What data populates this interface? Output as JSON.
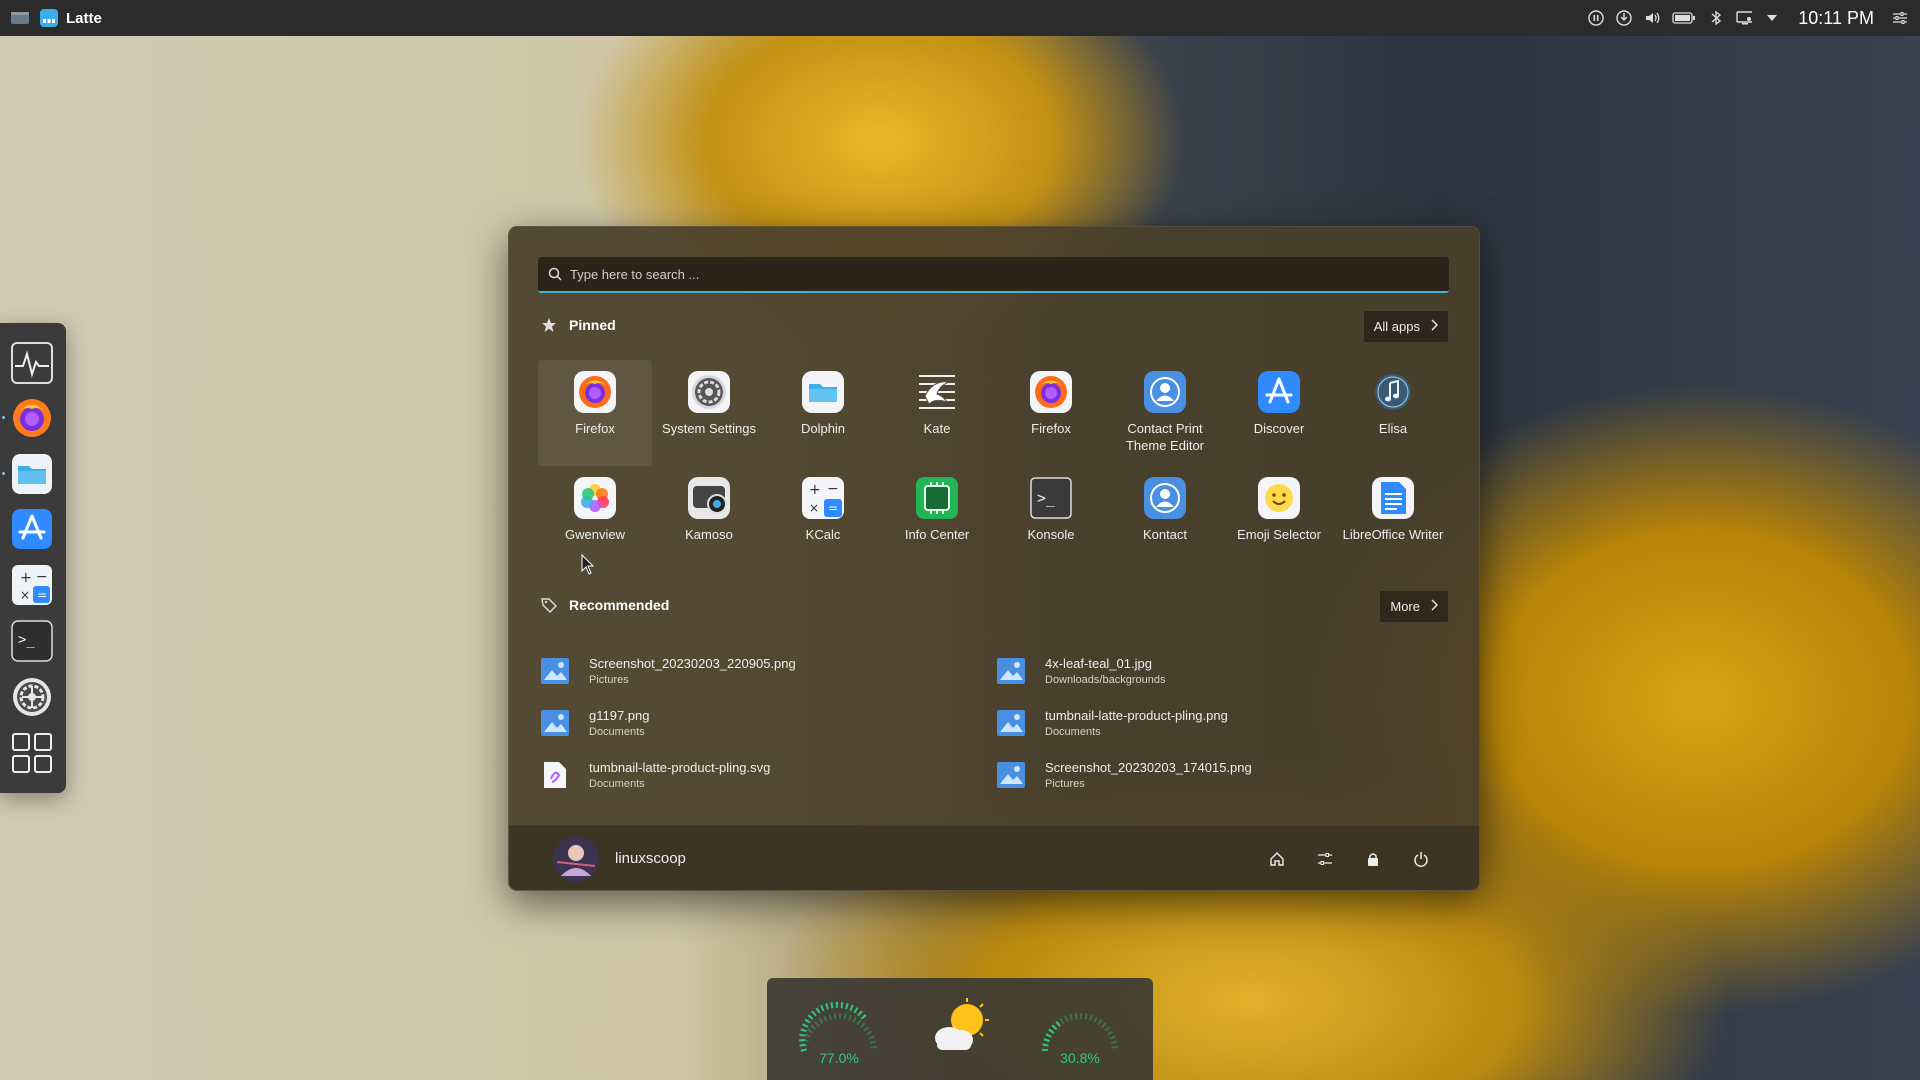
{
  "topbar": {
    "app_name": "Latte",
    "clock": "10:11 PM"
  },
  "dock": {
    "items": [
      {
        "name": "System Monitor"
      },
      {
        "name": "Firefox"
      },
      {
        "name": "Dolphin"
      },
      {
        "name": "Discover"
      },
      {
        "name": "KCalc"
      },
      {
        "name": "Konsole"
      },
      {
        "name": "System Settings"
      },
      {
        "name": "Application Launcher"
      }
    ]
  },
  "menu": {
    "search": {
      "placeholder": "Type here to search ..."
    },
    "pinned": {
      "title": "Pinned",
      "all_apps_label": "All apps",
      "apps": [
        {
          "label": "Firefox"
        },
        {
          "label": "System Settings"
        },
        {
          "label": "Dolphin"
        },
        {
          "label": "Kate"
        },
        {
          "label": "Firefox"
        },
        {
          "label": "Contact Print Theme Editor"
        },
        {
          "label": "Discover"
        },
        {
          "label": "Elisa"
        },
        {
          "label": "Gwenview"
        },
        {
          "label": "Kamoso"
        },
        {
          "label": "KCalc"
        },
        {
          "label": "Info Center"
        },
        {
          "label": "Konsole"
        },
        {
          "label": "Kontact"
        },
        {
          "label": "Emoji Selector"
        },
        {
          "label": "LibreOffice Writer"
        }
      ]
    },
    "recommended": {
      "title": "Recommended",
      "more_label": "More",
      "items": [
        {
          "name": "Screenshot_20230203_220905.png",
          "path": "Pictures"
        },
        {
          "name": "4x-leaf-teal_01.jpg",
          "path": "Downloads/backgrounds"
        },
        {
          "name": "g1197.png",
          "path": "Documents"
        },
        {
          "name": "tumbnail-latte-product-pling.png",
          "path": "Documents"
        },
        {
          "name": "tumbnail-latte-product-pling.svg",
          "path": "Documents"
        },
        {
          "name": "Screenshot_20230203_174015.png",
          "path": "Pictures"
        }
      ]
    },
    "footer": {
      "username": "linuxscoop"
    }
  },
  "widget": {
    "gauge_left": "77.0%",
    "gauge_right": "30.8%"
  },
  "colors": {
    "accent": "#3eb6d9",
    "gauge": "#2fc97e",
    "menu_bg": "#4a3f2a"
  }
}
